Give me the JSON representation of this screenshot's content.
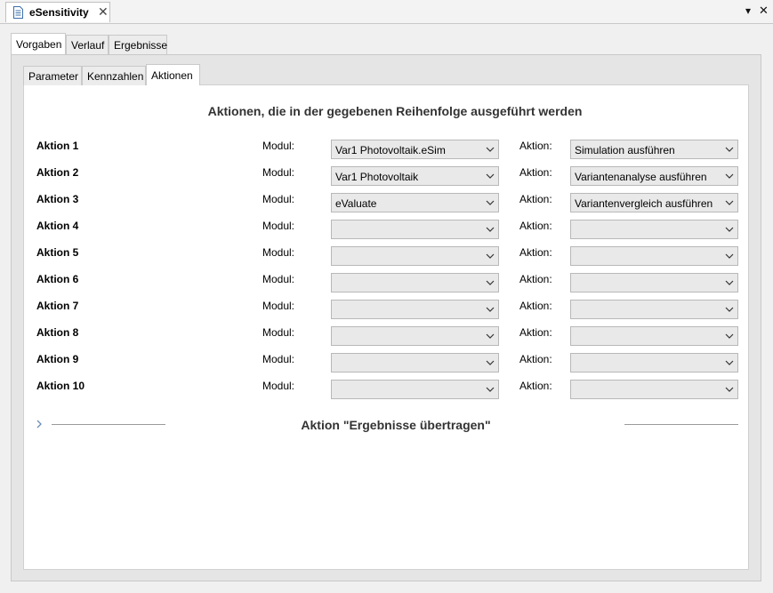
{
  "window": {
    "title": "eSensitivity",
    "close_glyph": "✕",
    "menu_glyph": "▾",
    "window_close_glyph": "✕"
  },
  "outer_tabs": [
    {
      "label": "Vorgaben",
      "active": true
    },
    {
      "label": "Verlauf",
      "active": false
    },
    {
      "label": "Ergebnisse",
      "active": false
    }
  ],
  "inner_tabs": [
    {
      "label": "Parameter",
      "active": false
    },
    {
      "label": "Kennzahlen",
      "active": false
    },
    {
      "label": "Aktionen",
      "active": true
    }
  ],
  "heading": "Aktionen, die in der gegebenen Reihenfolge ausgeführt werden",
  "modul_label": "Modul:",
  "aktion_label": "Aktion:",
  "rows": [
    {
      "label": "Aktion 1",
      "modul": "Var1 Photovoltaik.eSim",
      "aktion": "Simulation ausführen"
    },
    {
      "label": "Aktion 2",
      "modul": "Var1 Photovoltaik",
      "aktion": "Variantenanalyse ausführen"
    },
    {
      "label": "Aktion 3",
      "modul": "eValuate",
      "aktion": "Variantenvergleich ausführen"
    },
    {
      "label": "Aktion 4",
      "modul": "",
      "aktion": ""
    },
    {
      "label": "Aktion 5",
      "modul": "",
      "aktion": ""
    },
    {
      "label": "Aktion 6",
      "modul": "",
      "aktion": ""
    },
    {
      "label": "Aktion 7",
      "modul": "",
      "aktion": ""
    },
    {
      "label": "Aktion 8",
      "modul": "",
      "aktion": ""
    },
    {
      "label": "Aktion 9",
      "modul": "",
      "aktion": ""
    },
    {
      "label": "Aktion 10",
      "modul": "",
      "aktion": ""
    }
  ],
  "section": {
    "title": "Aktion \"Ergebnisse übertragen\"",
    "icon": "chevron-right-icon"
  },
  "colors": {
    "panel_bg": "#e5e5e5",
    "dropdown_bg": "#e9e9e9",
    "heading_text": "#333333"
  }
}
